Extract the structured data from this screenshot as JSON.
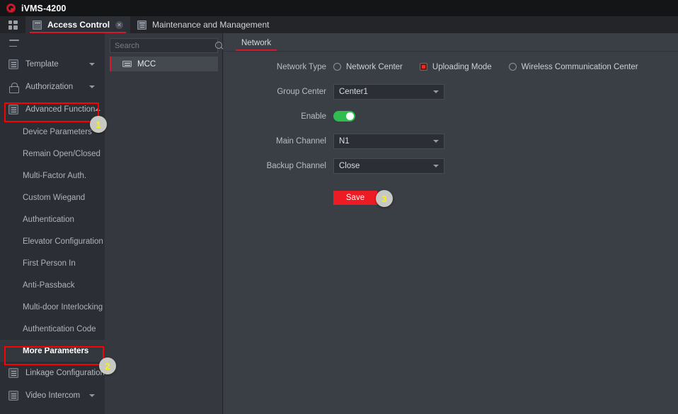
{
  "window": {
    "app_title": "iVMS-4200",
    "logo_icon": "hik-logo-icon"
  },
  "tabbar": {
    "grid_icon": "grid-icon",
    "tabs": [
      {
        "label": "Access Control",
        "icon": "panel-icon",
        "active": true,
        "close_icon": "close-icon"
      },
      {
        "label": "Maintenance and Management",
        "icon": "list-icon",
        "active": false
      }
    ]
  },
  "sidebar": {
    "menu_icon": "hamburger-icon",
    "items": [
      {
        "label": "Template",
        "icon": "template-icon",
        "type": "group",
        "caret": "down"
      },
      {
        "label": "Authorization",
        "icon": "lock-icon",
        "type": "group",
        "caret": "down"
      },
      {
        "label": "Advanced Function",
        "icon": "advanced-icon",
        "type": "group",
        "caret": "up",
        "highlighted": true
      },
      {
        "label": "Device Parameters",
        "type": "sub"
      },
      {
        "label": "Remain Open/Closed",
        "type": "sub"
      },
      {
        "label": "Multi-Factor Auth.",
        "type": "sub"
      },
      {
        "label": "Custom Wiegand",
        "type": "sub"
      },
      {
        "label": "Authentication",
        "type": "sub"
      },
      {
        "label": "Elevator Configuration",
        "type": "sub"
      },
      {
        "label": "First Person In",
        "type": "sub"
      },
      {
        "label": "Anti-Passback",
        "type": "sub"
      },
      {
        "label": "Multi-door Interlocking",
        "type": "sub"
      },
      {
        "label": "Authentication Code",
        "type": "sub"
      },
      {
        "label": "More Parameters",
        "type": "sub",
        "selected": true,
        "highlighted": true
      },
      {
        "label": "Linkage Configuration",
        "icon": "linkage-icon",
        "type": "group"
      },
      {
        "label": "Video Intercom",
        "icon": "intercom-icon",
        "type": "group",
        "caret": "down"
      }
    ]
  },
  "device_panel": {
    "search": {
      "placeholder": "Search",
      "value": "",
      "icon": "search-icon"
    },
    "devices": [
      {
        "name": "MCC",
        "icon": "device-icon",
        "selected": true
      }
    ]
  },
  "content": {
    "tabs": [
      {
        "label": "Network",
        "active": true
      }
    ],
    "form": {
      "network_type": {
        "label": "Network Type",
        "options": [
          {
            "label": "Network Center",
            "selected": false
          },
          {
            "label": "Uploading Mode",
            "selected": true
          },
          {
            "label": "Wireless Communication Center",
            "selected": false
          }
        ]
      },
      "group_center": {
        "label": "Group Center",
        "value": "Center1"
      },
      "enable": {
        "label": "Enable",
        "value": "on"
      },
      "main_channel": {
        "label": "Main Channel",
        "value": "N1"
      },
      "backup_channel": {
        "label": "Backup Channel",
        "value": "Close"
      },
      "save_label": "Save"
    }
  },
  "annotations": {
    "badges": [
      {
        "number": "1"
      },
      {
        "number": "2"
      },
      {
        "number": "3"
      }
    ]
  },
  "colors": {
    "accent_red": "#d7182a",
    "save_red": "#ed1c24",
    "toggle_green": "#2ebd4e",
    "annotation_red": "#ff0000",
    "badge_bg": "#c9c9c4",
    "badge_text": "#f5f21a"
  }
}
